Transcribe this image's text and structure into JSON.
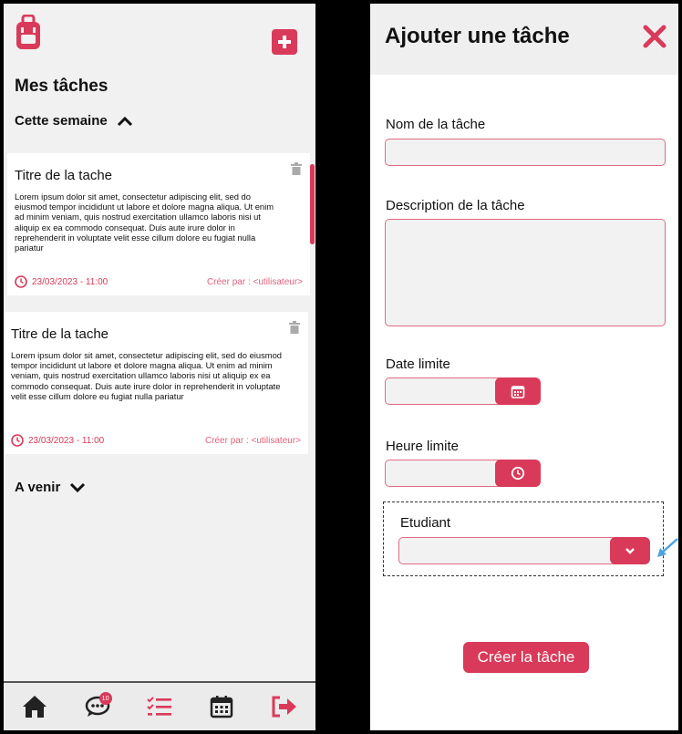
{
  "left": {
    "title": "Mes tâches",
    "section_week": "Cette semaine",
    "section_upcoming": "A venir",
    "tasks": [
      {
        "title": "Titre de la tache",
        "desc": "Lorem ipsum dolor sit amet, consectetur adipiscing elit, sed do eiusmod tempor incididunt ut labore et dolore magna aliqua. Ut enim ad minim veniam, quis nostrud exercitation ullamco laboris nisi ut aliquip ex ea commodo consequat. Duis aute irure dolor in reprehenderit in voluptate velit esse cillum dolore eu fugiat nulla pariatur",
        "datetime": "23/03/2023 - 11:00",
        "creator": "Créer par : <utilisateur>"
      },
      {
        "title": "Titre de la tache",
        "desc": "Lorem ipsum dolor sit amet, consectetur adipiscing elit, sed do eiusmod tempor incididunt ut labore et dolore magna aliqua. Ut enim ad minim veniam, quis nostrud exercitation ullamco laboris nisi ut aliquip ex ea commodo consequat. Duis aute irure dolor in reprehenderit in voluptate velit esse cillum dolore eu fugiat nulla pariatur",
        "datetime": "23/03/2023 - 11:00",
        "creator": "Créer par : <utilisateur>"
      }
    ],
    "nav": {
      "chat_badge": "10"
    }
  },
  "right": {
    "title": "Ajouter une tâche",
    "fields": {
      "name_label": "Nom de la tâche",
      "desc_label": "Description de la tâche",
      "date_label": "Date limite",
      "time_label": "Heure limite",
      "student_label": "Etudiant"
    },
    "submit_label": "Créer la tâche"
  },
  "colors": {
    "accent": "#d93a5a",
    "panel_bg": "#f1f1f1",
    "input_border": "#e06a82"
  }
}
